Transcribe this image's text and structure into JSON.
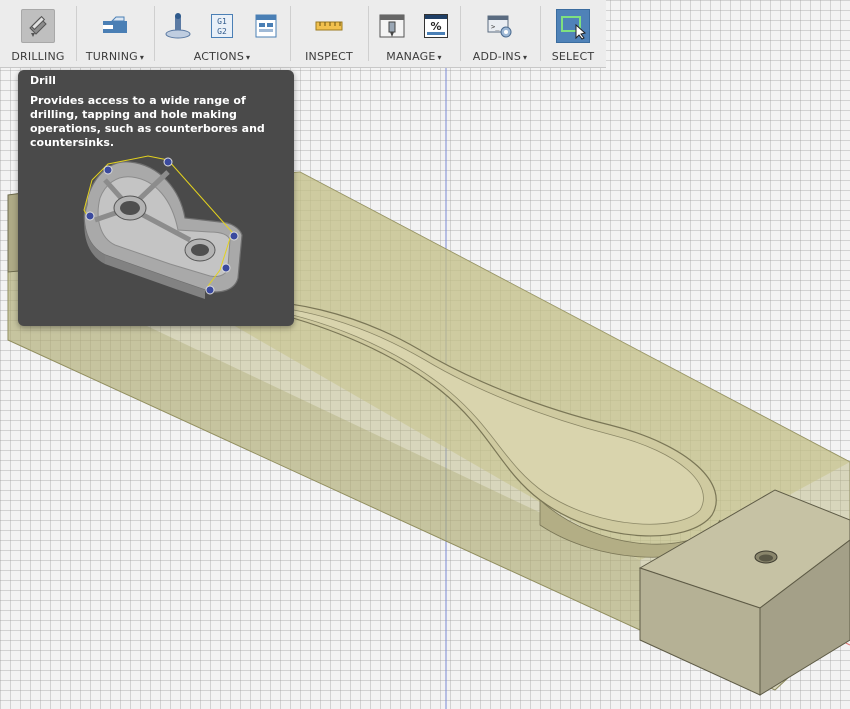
{
  "toolbar": {
    "groups": [
      {
        "label": "DRILLING",
        "has_dropdown": false,
        "icon": "drill-icon"
      },
      {
        "label": "TURNING",
        "has_dropdown": true,
        "icon": "turning-icon"
      },
      {
        "label": "ACTIONS",
        "has_dropdown": true,
        "icons": [
          "probe-icon",
          "g1-g2-icon",
          "setup-sheet-icon"
        ],
        "g_code_lines": [
          "G1",
          "G2"
        ]
      },
      {
        "label": "INSPECT",
        "has_dropdown": false,
        "icon": "measure-icon"
      },
      {
        "label": "MANAGE",
        "has_dropdown": true,
        "icons": [
          "tool-library-icon",
          "percent-icon"
        ],
        "percent_symbol": "%"
      },
      {
        "label": "ADD-INS",
        "has_dropdown": true,
        "icon": "scripts-icon"
      },
      {
        "label": "SELECT",
        "has_dropdown": false,
        "icon": "select-icon"
      }
    ],
    "dropdown_glyph": "▾"
  },
  "tooltip": {
    "title": "Drill",
    "description": "Provides access to a wide range of drilling, tapping and hole making operations, such as counterbores and countersinks.",
    "image": "drilled-part-illustration"
  },
  "colors": {
    "toolbar_bg": "#ececec",
    "tooltip_bg": "#4a4a4a",
    "select_active": "#4f82b8",
    "stock_fill": "#bdb98a",
    "block_face": "#bdb99d",
    "grid_line": "#c8c8c8"
  }
}
